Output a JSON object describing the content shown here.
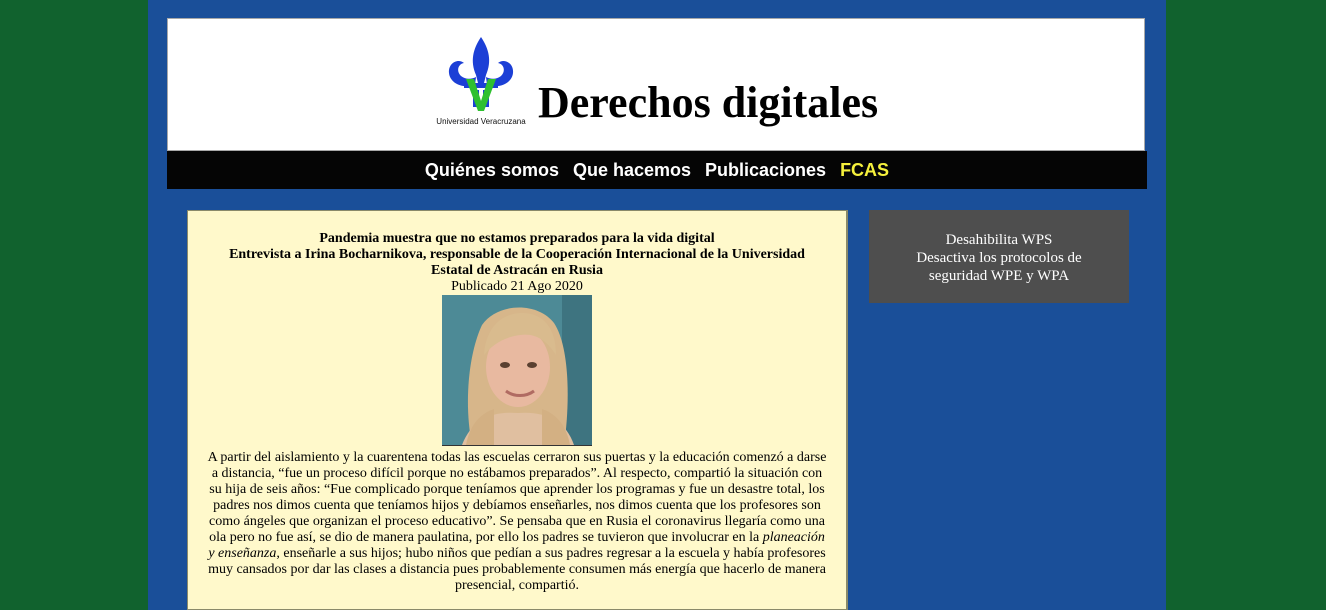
{
  "header": {
    "logo_caption": "Universidad Veracruzana",
    "title": "Derechos digitales"
  },
  "nav": {
    "items": [
      "Quiénes somos",
      "Que hacemos",
      "Publicaciones",
      "FCAS"
    ]
  },
  "article": {
    "headline": "Pandemia muestra que no estamos preparados para la vida digital",
    "subheadline": "Entrevista a Irina Bocharnikova, responsable de la Cooperación Internacional de la Universidad Estatal de Astracán en Rusia",
    "date": "Publicado 21 Ago 2020",
    "body_before": "A partir del aislamiento y la cuarentena todas las escuelas cerraron sus puertas y la educación comenzó a darse a distancia, “fue un proceso difícil porque no estábamos preparados”. Al respecto, compartió la situación con su hija de seis años: “Fue complicado porque teníamos que aprender los programas y fue un desastre total, los padres nos dimos cuenta que teníamos hijos y debíamos enseñarles, nos dimos cuenta que los profesores son como ángeles que organizan el proceso educativo”. Se pensaba que en Rusia el coronavirus llegaría como una ola pero no fue así, se dio de manera paulatina, por ello los padres se tuvieron que involucrar en la ",
    "body_emphasis": "planeación y enseñanza",
    "body_after": ", enseñarle a sus hijos; hubo niños que pedían a sus padres regresar a la escuela y había profesores muy cansados por dar las clases a distancia pues probablemente consumen más energía que hacerlo de manera presencial, compartió."
  },
  "sidebar": {
    "link_title": "Desahibilita WPS",
    "link_subtitle": "Desactiva los protocolos de seguridad WPE y WPA"
  },
  "colors": {
    "outer_background": "#11622e",
    "main_column": "#1a4f99",
    "article_background": "#fff9cb",
    "nav_background": "#050505",
    "nav_highlight": "#f5f03c",
    "sidebar_box": "#4e4e4e"
  }
}
